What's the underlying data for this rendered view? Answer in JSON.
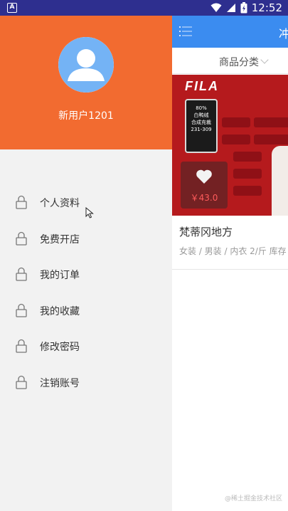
{
  "status_bar": {
    "left_icon_text": "A",
    "time": "12:52",
    "battery_glyph": "ϟ"
  },
  "main": {
    "toolbar_title": "冲",
    "category_label": "商品分类",
    "banner": {
      "brand": "FILA",
      "poster_lines": [
        "80%",
        "白鸭绒",
        "合成充裁",
        "231-309"
      ]
    },
    "product": {
      "price": "￥43.0",
      "name": "梵蒂冈地方",
      "tags": "女装 / 男装 / 内衣  2/斤 库存"
    },
    "watermark": "@稀土掘金技术社区"
  },
  "drawer": {
    "username": "新用户1201",
    "menu_items": [
      {
        "label": "个人资料"
      },
      {
        "label": "免费开店"
      },
      {
        "label": "我的订单"
      },
      {
        "label": "我的收藏"
      },
      {
        "label": "修改密码"
      },
      {
        "label": "注销账号"
      }
    ]
  },
  "colors": {
    "status_bar": "#2e2f8f",
    "drawer_header": "#f26b30",
    "toolbar": "#3b8cf0",
    "avatar_blue": "#74b3f5",
    "drawer_bg": "#f2f2f2",
    "price_red": "#ff5b5b"
  },
  "icons": [
    "menu-icon",
    "category-chevron-icon",
    "heart-icon",
    "lock-icon",
    "cursor-icon",
    "wifi-icon",
    "signal-icon",
    "battery-icon"
  ]
}
